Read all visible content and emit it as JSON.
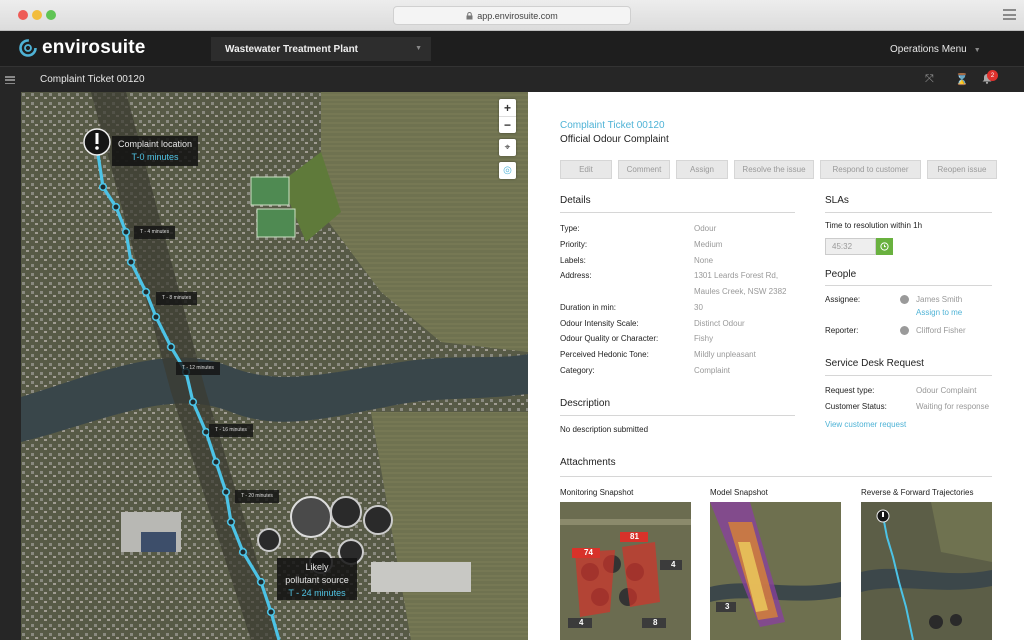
{
  "browser": {
    "url": "app.envirosuite.com"
  },
  "app": {
    "brand": "envirosuite",
    "site_selector": "Wastewater Treatment Plant",
    "operations_menu": "Operations Menu",
    "notification_count": "2"
  },
  "subheader": {
    "title": "Complaint Ticket 00120"
  },
  "map": {
    "complaint_label": "Complaint location",
    "complaint_time": "T-0 minutes",
    "markers": [
      "T - 4 minutes",
      "T - 8 minutes",
      "T - 12 minutes",
      "T - 16 minutes",
      "T - 20 minutes"
    ],
    "source_label_1": "Likely",
    "source_label_2": "pollutant source",
    "source_time": "T - 24 minutes",
    "zoom_in": "+",
    "zoom_out": "−"
  },
  "ticket": {
    "id_link": "Complaint Ticket 00120",
    "subtitle": "Official Odour Complaint",
    "actions": [
      "Edit",
      "Comment",
      "Assign",
      "Resolve the issue",
      "Respond to customer",
      "Reopen issue"
    ]
  },
  "details": {
    "heading": "Details",
    "fields": [
      {
        "label": "Type:",
        "value": "Odour"
      },
      {
        "label": "Priority:",
        "value": "Medium"
      },
      {
        "label": "Labels:",
        "value": "None"
      },
      {
        "label": "Address:",
        "value": "1301 Leards Forest Rd,",
        "value2": "Maules Creek, NSW 2382"
      },
      {
        "label": "Duration in min:",
        "value": "30"
      },
      {
        "label": "Odour Intensity Scale:",
        "value": "Distinct Odour"
      },
      {
        "label": "Odour Quality or Character:",
        "value": "Fishy"
      },
      {
        "label": "Perceived Hedonic Tone:",
        "value": "Mildly unpleasant"
      },
      {
        "label": "Category:",
        "value": "Complaint"
      }
    ]
  },
  "description": {
    "heading": "Description",
    "text": "No description submitted"
  },
  "slas": {
    "heading": "SLAs",
    "label": "Time to resolution within 1h",
    "timer": "45:32"
  },
  "people": {
    "heading": "People",
    "assignee_label": "Assignee:",
    "assignee": "James Smith",
    "assign_link": "Assign to me",
    "reporter_label": "Reporter:",
    "reporter": "Clifford Fisher"
  },
  "service_desk": {
    "heading": "Service Desk Request",
    "request_type_label": "Request type:",
    "request_type": "Odour Complaint",
    "status_label": "Customer Status:",
    "status": "Waiting for response",
    "view_link": "View customer request"
  },
  "attachments": {
    "heading": "Attachments",
    "items": [
      "Monitoring Snapshot",
      "Model Snapshot",
      "Reverse & Forward Trajectories"
    ],
    "monitoring_values": [
      "74",
      "81",
      "4",
      "4",
      "8"
    ],
    "model_values": [
      "3"
    ]
  },
  "colors": {
    "accent": "#4fb3d6",
    "trajectory": "#4cc3e6",
    "ok_green": "#69b13f",
    "alert_red": "#e0312d"
  }
}
